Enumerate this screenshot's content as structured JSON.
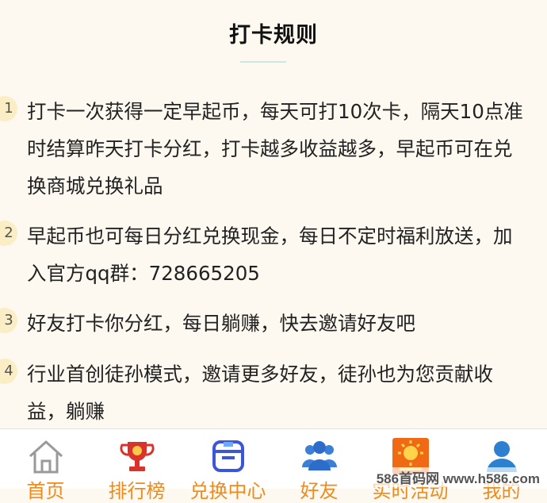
{
  "header": {
    "title": "打卡规则"
  },
  "rules": [
    {
      "num": "1",
      "text": "打卡一次获得一定早起币，每天可打10次卡，隔天10点准时结算昨天打卡分红，打卡越多收益越多，早起币可在兑换商城兑换礼品"
    },
    {
      "num": "2",
      "text": "早起币也可每日分红兑换现金，每日不定时福利放送，加入官方qq群：728665205"
    },
    {
      "num": "3",
      "text": "好友打卡你分红，每日躺赚，快去邀请好友吧"
    },
    {
      "num": "4",
      "text": "行业首创徒孙模式，邀请更多好友，徒孙也为您贡献收益，躺赚"
    }
  ],
  "tabbar": {
    "items": [
      {
        "label": "首页",
        "icon": "home-icon"
      },
      {
        "label": "排行榜",
        "icon": "trophy-icon"
      },
      {
        "label": "兑换中心",
        "icon": "shop-icon"
      },
      {
        "label": "好友",
        "icon": "friends-icon"
      },
      {
        "label": "实时活动",
        "icon": "activity-icon"
      },
      {
        "label": "我的",
        "icon": "user-icon"
      }
    ]
  },
  "watermark": "586首码网 www.h586.com",
  "colors": {
    "background": "#fdf9f0",
    "accent": "#ef8a1b",
    "badge": "#fbeec5"
  }
}
